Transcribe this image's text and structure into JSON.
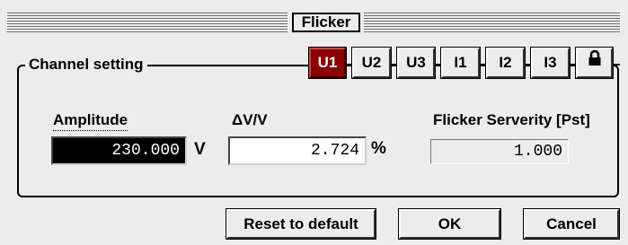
{
  "window": {
    "title": "Flicker"
  },
  "group": {
    "label": "Channel setting"
  },
  "tabs": [
    {
      "label": "U1",
      "active": true
    },
    {
      "label": "U2",
      "active": false
    },
    {
      "label": "U3",
      "active": false
    },
    {
      "label": "I1",
      "active": false
    },
    {
      "label": "I2",
      "active": false
    },
    {
      "label": "I3",
      "active": false
    },
    {
      "label": "",
      "icon": "lock-icon",
      "active": false
    }
  ],
  "fields": {
    "amplitude": {
      "label": "Amplitude",
      "value": "230.000",
      "unit": "V"
    },
    "delta_v": {
      "label": "ΔV/V",
      "value": "2.724",
      "unit": "%"
    },
    "severity": {
      "label": "Flicker Serverity [Pst]",
      "value": "1.000"
    }
  },
  "buttons": {
    "reset": "Reset to default",
    "ok": "OK",
    "cancel": "Cancel"
  },
  "colors": {
    "active_tab": "#8b0000",
    "background": "#ececec"
  }
}
